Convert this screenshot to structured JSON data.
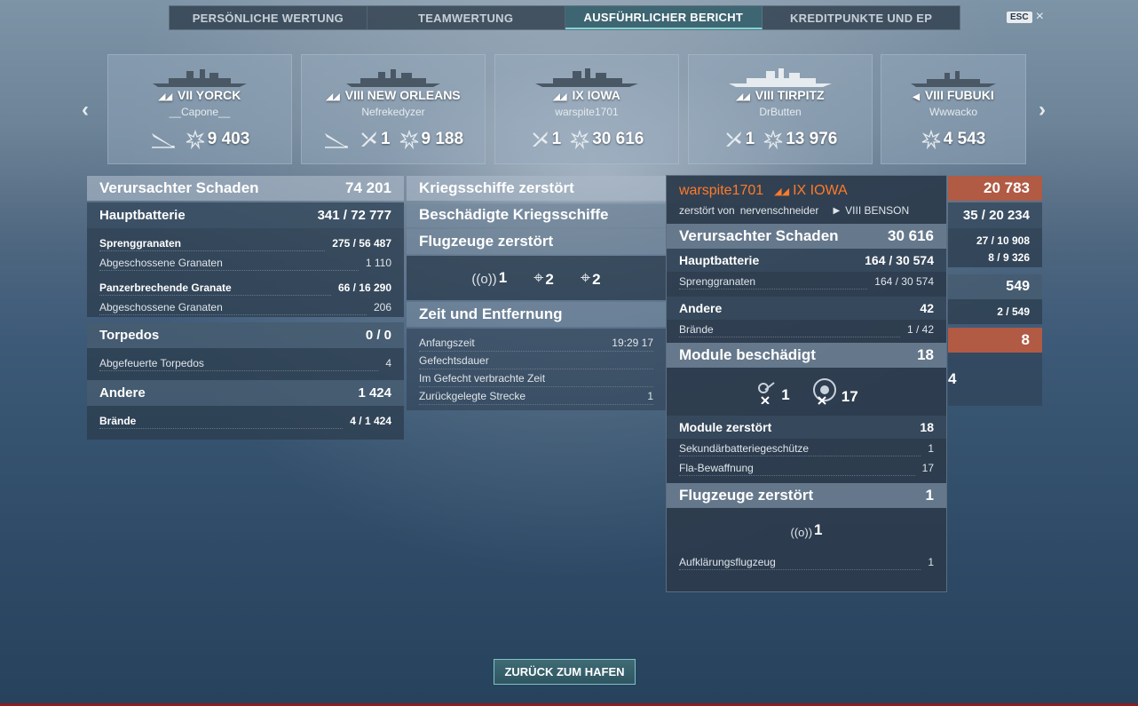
{
  "tabs": [
    {
      "label": "PERSÖNLICHE WERTUNG"
    },
    {
      "label": "TEAMWERTUNG"
    },
    {
      "label": "AUSFÜHRLICHER BERICHT"
    },
    {
      "label": "KREDITPUNKTE UND EP"
    }
  ],
  "esc": {
    "key": "ESC",
    "close": "×"
  },
  "ships": [
    {
      "tier": "VII",
      "name": "YORCK",
      "player": "__Capone__",
      "destroyed": "",
      "damage": "9 403"
    },
    {
      "tier": "VIII",
      "name": "NEW ORLEANS",
      "player": "Nefrekedyzer",
      "destroyed": "1",
      "damage": "9 188"
    },
    {
      "tier": "IX",
      "name": "IOWA",
      "player": "warspite1701",
      "destroyed": "1",
      "damage": "30 616"
    },
    {
      "tier": "VIII",
      "name": "TIRPITZ",
      "player": "DrButten",
      "destroyed": "1",
      "damage": "13 976"
    },
    {
      "tier": "VIII",
      "name": "FUBUKI",
      "player": "Wwwacko",
      "destroyed": "",
      "damage": "4 543"
    }
  ],
  "left": {
    "damage_label": "Verursachter Schaden",
    "damage_value": "74 201",
    "main_label": "Hauptbatterie",
    "main_value": "341 / 72 777",
    "he_label": "Sprenggranaten",
    "he_value": "275 / 56 487",
    "he_fired_label": "Abgeschossene Granaten",
    "he_fired_value": "1 110",
    "ap_label": "Panzerbrechende Granate",
    "ap_value": "66 / 16 290",
    "ap_fired_label": "Abgeschossene Granaten",
    "ap_fired_value": "206",
    "torp_label": "Torpedos",
    "torp_value": "0 / 0",
    "torp_fired_label": "Abgefeuerte Torpedos",
    "torp_fired_value": "4",
    "other_label": "Andere",
    "other_value": "1 424",
    "fires_label": "Brände",
    "fires_value": "4 / 1 424"
  },
  "middle": {
    "destroyed_ships": "Kriegsschiffe zerstört",
    "damaged_ships": "Beschädigte Kriegsschiffe",
    "planes_destroyed": "Flugzeuge zerstört",
    "planes": [
      {
        "icon": "((o))",
        "count": "1"
      },
      {
        "icon": "⌖",
        "count": "2"
      },
      {
        "icon": "⌖",
        "count": "2"
      }
    ],
    "time_header": "Zeit und Entfernung",
    "start_label": "Anfangszeit",
    "start_value": "19:29  17",
    "duration_label": "Gefechtsdauer",
    "time_in_battle_label": "Im Gefecht verbrachte Zeit",
    "distance_label": "Zurückgelegte Strecke",
    "distance_value": "1"
  },
  "right": {
    "v1": "20 783",
    "v2": "35 / 20 234",
    "v3": "27 / 10 908",
    "v4": "8 / 9 326",
    "v5": "549",
    "v6": "2 / 549",
    "v7": "8",
    "v8": "4"
  },
  "tooltip": {
    "player": "warspite1701",
    "ship": "IX IOWA",
    "killed_by_label": "zerstört von",
    "killer": "nervenschneider",
    "killer_ship": "VIII BENSON",
    "damage_label": "Verursachter Schaden",
    "damage_value": "30 616",
    "main_label": "Hauptbatterie",
    "main_value": "164 / 30 574",
    "he_label": "Sprenggranaten",
    "he_value": "164 / 30 574",
    "other_label": "Andere",
    "other_value": "42",
    "fires_label": "Brände",
    "fires_value": "1 / 42",
    "mod_damaged_label": "Module beschädigt",
    "mod_damaged_value": "18",
    "mod_icon1_count": "1",
    "mod_icon2_count": "17",
    "mod_destroyed_label": "Module zerstört",
    "mod_destroyed_value": "18",
    "secondary_label": "Sekundärbatteriegeschütze",
    "secondary_value": "1",
    "aa_label": "Fla-Bewaffnung",
    "aa_value": "17",
    "planes_label": "Flugzeuge zerstört",
    "planes_value": "1",
    "plane_icon_count": "1",
    "recon_label": "Aufklärungsflugzeug",
    "recon_value": "1"
  },
  "back_button": "ZURÜCK ZUM HAFEN",
  "colors": {
    "accent": "#7fd3d3",
    "highlight": "#ff7a2a",
    "red_bar": "#b15a44"
  }
}
